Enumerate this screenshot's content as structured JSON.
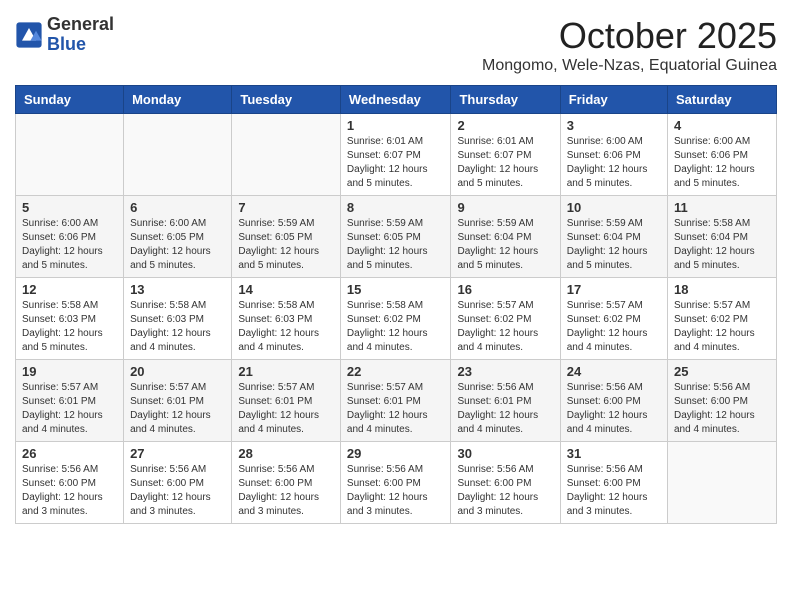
{
  "header": {
    "logo_general": "General",
    "logo_blue": "Blue",
    "month_title": "October 2025",
    "location": "Mongomo, Wele-Nzas, Equatorial Guinea"
  },
  "calendar": {
    "days_of_week": [
      "Sunday",
      "Monday",
      "Tuesday",
      "Wednesday",
      "Thursday",
      "Friday",
      "Saturday"
    ],
    "weeks": [
      [
        {
          "day": "",
          "info": ""
        },
        {
          "day": "",
          "info": ""
        },
        {
          "day": "",
          "info": ""
        },
        {
          "day": "1",
          "info": "Sunrise: 6:01 AM\nSunset: 6:07 PM\nDaylight: 12 hours\nand 5 minutes."
        },
        {
          "day": "2",
          "info": "Sunrise: 6:01 AM\nSunset: 6:07 PM\nDaylight: 12 hours\nand 5 minutes."
        },
        {
          "day": "3",
          "info": "Sunrise: 6:00 AM\nSunset: 6:06 PM\nDaylight: 12 hours\nand 5 minutes."
        },
        {
          "day": "4",
          "info": "Sunrise: 6:00 AM\nSunset: 6:06 PM\nDaylight: 12 hours\nand 5 minutes."
        }
      ],
      [
        {
          "day": "5",
          "info": "Sunrise: 6:00 AM\nSunset: 6:06 PM\nDaylight: 12 hours\nand 5 minutes."
        },
        {
          "day": "6",
          "info": "Sunrise: 6:00 AM\nSunset: 6:05 PM\nDaylight: 12 hours\nand 5 minutes."
        },
        {
          "day": "7",
          "info": "Sunrise: 5:59 AM\nSunset: 6:05 PM\nDaylight: 12 hours\nand 5 minutes."
        },
        {
          "day": "8",
          "info": "Sunrise: 5:59 AM\nSunset: 6:05 PM\nDaylight: 12 hours\nand 5 minutes."
        },
        {
          "day": "9",
          "info": "Sunrise: 5:59 AM\nSunset: 6:04 PM\nDaylight: 12 hours\nand 5 minutes."
        },
        {
          "day": "10",
          "info": "Sunrise: 5:59 AM\nSunset: 6:04 PM\nDaylight: 12 hours\nand 5 minutes."
        },
        {
          "day": "11",
          "info": "Sunrise: 5:58 AM\nSunset: 6:04 PM\nDaylight: 12 hours\nand 5 minutes."
        }
      ],
      [
        {
          "day": "12",
          "info": "Sunrise: 5:58 AM\nSunset: 6:03 PM\nDaylight: 12 hours\nand 5 minutes."
        },
        {
          "day": "13",
          "info": "Sunrise: 5:58 AM\nSunset: 6:03 PM\nDaylight: 12 hours\nand 4 minutes."
        },
        {
          "day": "14",
          "info": "Sunrise: 5:58 AM\nSunset: 6:03 PM\nDaylight: 12 hours\nand 4 minutes."
        },
        {
          "day": "15",
          "info": "Sunrise: 5:58 AM\nSunset: 6:02 PM\nDaylight: 12 hours\nand 4 minutes."
        },
        {
          "day": "16",
          "info": "Sunrise: 5:57 AM\nSunset: 6:02 PM\nDaylight: 12 hours\nand 4 minutes."
        },
        {
          "day": "17",
          "info": "Sunrise: 5:57 AM\nSunset: 6:02 PM\nDaylight: 12 hours\nand 4 minutes."
        },
        {
          "day": "18",
          "info": "Sunrise: 5:57 AM\nSunset: 6:02 PM\nDaylight: 12 hours\nand 4 minutes."
        }
      ],
      [
        {
          "day": "19",
          "info": "Sunrise: 5:57 AM\nSunset: 6:01 PM\nDaylight: 12 hours\nand 4 minutes."
        },
        {
          "day": "20",
          "info": "Sunrise: 5:57 AM\nSunset: 6:01 PM\nDaylight: 12 hours\nand 4 minutes."
        },
        {
          "day": "21",
          "info": "Sunrise: 5:57 AM\nSunset: 6:01 PM\nDaylight: 12 hours\nand 4 minutes."
        },
        {
          "day": "22",
          "info": "Sunrise: 5:57 AM\nSunset: 6:01 PM\nDaylight: 12 hours\nand 4 minutes."
        },
        {
          "day": "23",
          "info": "Sunrise: 5:56 AM\nSunset: 6:01 PM\nDaylight: 12 hours\nand 4 minutes."
        },
        {
          "day": "24",
          "info": "Sunrise: 5:56 AM\nSunset: 6:00 PM\nDaylight: 12 hours\nand 4 minutes."
        },
        {
          "day": "25",
          "info": "Sunrise: 5:56 AM\nSunset: 6:00 PM\nDaylight: 12 hours\nand 4 minutes."
        }
      ],
      [
        {
          "day": "26",
          "info": "Sunrise: 5:56 AM\nSunset: 6:00 PM\nDaylight: 12 hours\nand 3 minutes."
        },
        {
          "day": "27",
          "info": "Sunrise: 5:56 AM\nSunset: 6:00 PM\nDaylight: 12 hours\nand 3 minutes."
        },
        {
          "day": "28",
          "info": "Sunrise: 5:56 AM\nSunset: 6:00 PM\nDaylight: 12 hours\nand 3 minutes."
        },
        {
          "day": "29",
          "info": "Sunrise: 5:56 AM\nSunset: 6:00 PM\nDaylight: 12 hours\nand 3 minutes."
        },
        {
          "day": "30",
          "info": "Sunrise: 5:56 AM\nSunset: 6:00 PM\nDaylight: 12 hours\nand 3 minutes."
        },
        {
          "day": "31",
          "info": "Sunrise: 5:56 AM\nSunset: 6:00 PM\nDaylight: 12 hours\nand 3 minutes."
        },
        {
          "day": "",
          "info": ""
        }
      ]
    ]
  }
}
